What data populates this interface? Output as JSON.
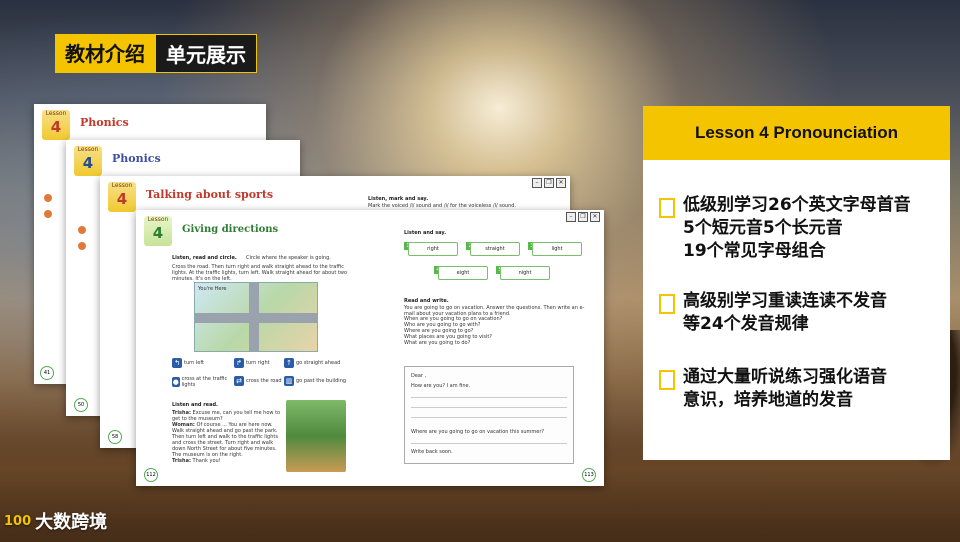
{
  "header": {
    "title_left": "教材介绍",
    "title_right": "单元展示"
  },
  "pages": [
    {
      "lesson_label": "Lesson",
      "lesson_num": "4",
      "title": "Phonics",
      "page_no": "41"
    },
    {
      "lesson_label": "Lesson",
      "lesson_num": "4",
      "title": "Phonics",
      "page_no": "50"
    },
    {
      "lesson_label": "Lesson",
      "lesson_num": "4",
      "title": "Talking about sports",
      "page_no": "58",
      "exercise3": "Listen, mark and say.",
      "exercise3_detail": "Mark the voiced /l/ sound and /i/ for the voiceless /l/ sound."
    },
    {
      "lesson_label": "Lesson",
      "lesson_num": "4",
      "title": "Giving directions",
      "page_no_left": "112",
      "page_no_right": "113",
      "ex1_title": "Listen, read and circle.",
      "ex1_detail": "Circle where the speaker is going.",
      "ex1_text": "Cross the road. Then turn right and walk straight ahead to the traffic lights. At the traffic lights, turn left. Walk straight ahead for about two minutes. It's on the left.",
      "map_label": "You're Here",
      "directions": [
        "turn left",
        "turn right",
        "go straight ahead",
        "cross at the traffic lights",
        "cross the road",
        "go past the building"
      ],
      "ex2_title": "Listen and read.",
      "dialog": [
        {
          "speaker": "Trisha:",
          "line": "Excuse me, can you tell me how to get to the museum?"
        },
        {
          "speaker": "Woman:",
          "line": "Of course ... You are here now. Walk straight ahead and go past the park. Then turn left and walk to the traffic lights and cross the street. Turn right and walk down North Street for about five minutes. The museum is on the right."
        },
        {
          "speaker": "Trisha:",
          "line": "Thank you!"
        }
      ],
      "ex3_title": "Listen and say.",
      "words": [
        "right",
        "straight",
        "light",
        "eight",
        "night"
      ],
      "ex4_title": "Read and write.",
      "ex4_detail": "You are going to go on vacation. Answer the questions. Then write an e-mail about your vacation plans to a friend.",
      "questions": [
        "When are you going to go on vacation?",
        "Who are you going to go with?",
        "Where are you going to go?",
        "What places are you going to visit?",
        "What are you going to do?"
      ],
      "email": {
        "greeting": "Dear ,",
        "line1": "How are you? I am fine.",
        "line2": "Where are you going to go on vacation this summer?",
        "sign": "Write back soon."
      }
    }
  ],
  "info": {
    "header": "Lesson 4 Pronounciation",
    "bullets": [
      [
        "低级别学习26个英文字母首音",
        "5个短元音5个长元音",
        "19个常见字母组合"
      ],
      [
        "高级别学习重读连读不发音",
        "等24个发音规律"
      ],
      [
        "通过大量听说练习强化语音",
        "意识，培养地道的发音"
      ]
    ]
  },
  "logo": {
    "text": "大数跨境",
    "mark": "100"
  },
  "colors": {
    "accent": "#f5c400",
    "dark": "#1a1a1a"
  }
}
